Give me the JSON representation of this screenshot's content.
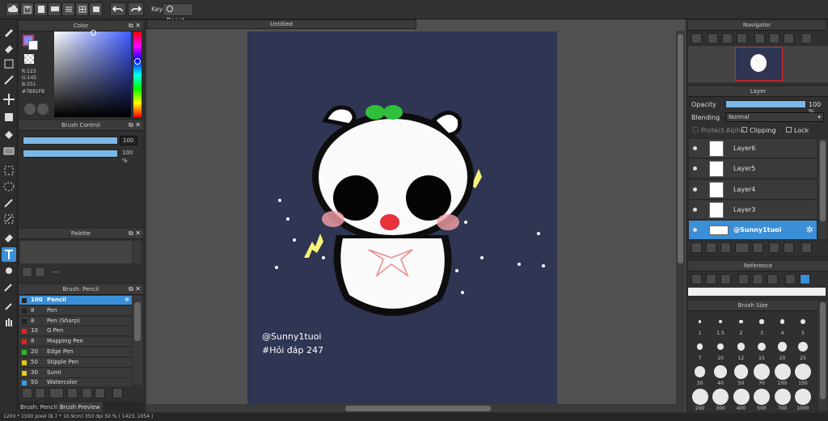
{
  "toolbar": {
    "key_label": "Key",
    "reset_label": "Reset"
  },
  "document": {
    "title": "Untitled"
  },
  "color_panel": {
    "title": "Color",
    "rgb": "R:123\nG:145\nB:251",
    "hex": "#7B91FB",
    "main_color": "#7b91fb"
  },
  "brush_control": {
    "title": "Brush Control",
    "size": "100",
    "opacity": "100 %"
  },
  "palette": {
    "title": "Palette",
    "value": "---"
  },
  "brush_panel": {
    "title": "Brush: Pencil",
    "items": [
      {
        "size": "100",
        "name": "Pencil",
        "color": "#222222"
      },
      {
        "size": "8",
        "name": "Pen",
        "color": "#222222"
      },
      {
        "size": "8",
        "name": "Pen (Sharp)",
        "color": "#222222"
      },
      {
        "size": "10",
        "name": "G Pen",
        "color": "#e02424"
      },
      {
        "size": "8",
        "name": "Mapping Pen",
        "color": "#e02424"
      },
      {
        "size": "20",
        "name": "Edge Pen",
        "color": "#2ab82a"
      },
      {
        "size": "50",
        "name": "Stipple Pen",
        "color": "#e8c81c"
      },
      {
        "size": "30",
        "name": "Sumi",
        "color": "#e8c81c"
      },
      {
        "size": "50",
        "name": "Watercolor",
        "color": "#3aa0e8"
      }
    ],
    "tabs": [
      "Brush: Pencil",
      "Brush Preview"
    ]
  },
  "navigator": {
    "title": "Navigator"
  },
  "layer_panel": {
    "title": "Layer",
    "opacity_label": "Opacity",
    "opacity_value": "100 %",
    "opacity_fraction": 1.0,
    "blending_label": "Blending",
    "blending_value": "Normal",
    "protect_alpha": "Protect Alpha",
    "clipping": "Clipping",
    "lock": "Lock",
    "layers": [
      "Layer6",
      "Layer5",
      "Layer4",
      "Layer3",
      "@Sunny1tuoi"
    ]
  },
  "reference": {
    "title": "Reference"
  },
  "brush_size": {
    "title": "Brush Size",
    "sizes": [
      "1",
      "1.5",
      "2",
      "3",
      "4",
      "5",
      "7",
      "10",
      "12",
      "15",
      "20",
      "25",
      "30",
      "40",
      "50",
      "70",
      "100",
      "150",
      "200",
      "300",
      "400",
      "500",
      "700",
      "1000"
    ]
  },
  "canvas_text": {
    "line1": "@Sunny1tuoi",
    "line2": "#Hỏi đáp 247"
  },
  "status": {
    "text": "1200 * 1500 pixel   (8.7 * 10.9cm)   350 dpi   50 %   ( 1423, 1054 )"
  }
}
